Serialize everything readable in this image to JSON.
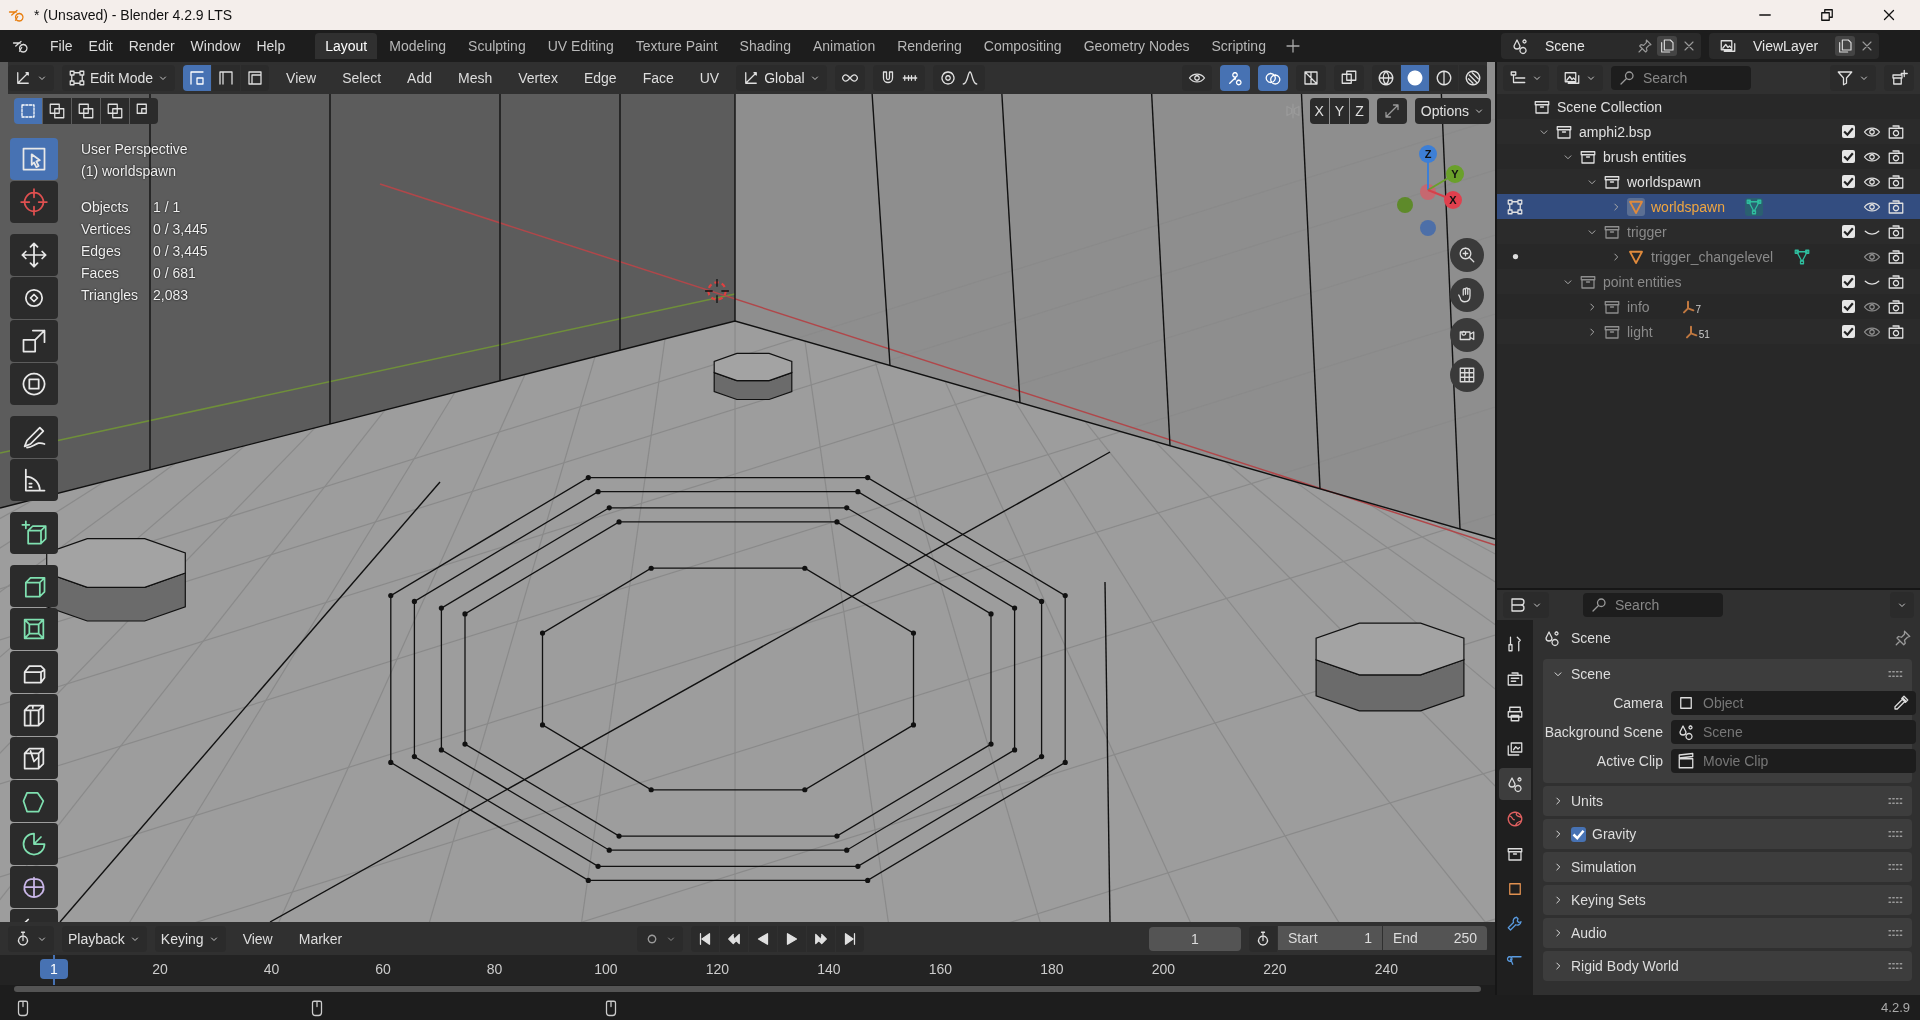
{
  "window": {
    "title": "* (Unsaved) - Blender 4.2.9 LTS"
  },
  "menu": [
    "File",
    "Edit",
    "Render",
    "Window",
    "Help"
  ],
  "workspaces": [
    {
      "label": "Layout",
      "selected": true
    },
    {
      "label": "Modeling",
      "selected": false
    },
    {
      "label": "Sculpting",
      "selected": false
    },
    {
      "label": "UV Editing",
      "selected": false
    },
    {
      "label": "Texture Paint",
      "selected": false
    },
    {
      "label": "Shading",
      "selected": false
    },
    {
      "label": "Animation",
      "selected": false
    },
    {
      "label": "Rendering",
      "selected": false
    },
    {
      "label": "Compositing",
      "selected": false
    },
    {
      "label": "Geometry Nodes",
      "selected": false
    },
    {
      "label": "Scripting",
      "selected": false
    }
  ],
  "scene": {
    "name": "Scene"
  },
  "view_layer": {
    "name": "ViewLayer"
  },
  "viewport": {
    "mode": "Edit Mode",
    "select_modes": [
      {
        "kind": "vertex",
        "selected": true
      },
      {
        "kind": "edge",
        "selected": false
      },
      {
        "kind": "face",
        "selected": false
      }
    ],
    "menus": [
      "View",
      "Select",
      "Add",
      "Mesh",
      "Vertex",
      "Edge",
      "Face",
      "UV"
    ],
    "orientation": "Global",
    "gizmos_on": true,
    "overlays_on": true,
    "shading": [
      {
        "kind": "wireframe",
        "selected": false
      },
      {
        "kind": "solid",
        "selected": true
      },
      {
        "kind": "material",
        "selected": false
      },
      {
        "kind": "rendered",
        "selected": false
      }
    ],
    "box_modes": [
      {
        "kind": "new",
        "selected": true
      },
      {
        "kind": "extend",
        "selected": false
      },
      {
        "kind": "subtract",
        "selected": false
      },
      {
        "kind": "invert",
        "selected": false
      },
      {
        "kind": "intersect",
        "selected": false
      }
    ],
    "mirror_axes": [
      {
        "label": "X",
        "selected": false
      },
      {
        "label": "Y",
        "selected": false
      },
      {
        "label": "Z",
        "selected": false
      }
    ],
    "options": "Options",
    "view_name": "User Perspective",
    "object_name": "(1) worldspawn",
    "stats": [
      {
        "label": "Objects",
        "value": "1 / 1"
      },
      {
        "label": "Vertices",
        "value": "0 / 3,445"
      },
      {
        "label": "Edges",
        "value": "0 / 3,445"
      },
      {
        "label": "Faces",
        "value": "0 / 681"
      },
      {
        "label": "Triangles",
        "value": "2,083"
      }
    ],
    "axis_labels": [
      "Z",
      "Y",
      "X"
    ],
    "tools": [
      {
        "kind": "select-box",
        "selected": true
      },
      {
        "kind": "cursor",
        "selected": false
      },
      {
        "kind": "move",
        "selected": false
      },
      {
        "kind": "rotate",
        "selected": false
      },
      {
        "kind": "scale",
        "selected": false
      },
      {
        "kind": "transform",
        "selected": false
      },
      {
        "kind": "annotate",
        "selected": false
      },
      {
        "kind": "measure",
        "selected": false
      },
      {
        "kind": "add-cube",
        "selected": false
      },
      {
        "kind": "extrude",
        "selected": false
      },
      {
        "kind": "inset",
        "selected": false
      },
      {
        "kind": "bevel",
        "selected": false
      },
      {
        "kind": "loop-cut",
        "selected": false
      },
      {
        "kind": "knife",
        "selected": false
      },
      {
        "kind": "poly-build",
        "selected": false
      },
      {
        "kind": "spin",
        "selected": false
      },
      {
        "kind": "smooth",
        "selected": false
      },
      {
        "kind": "shear",
        "selected": false
      }
    ]
  },
  "outliner": {
    "search": {
      "placeholder": "Search"
    },
    "root": "Scene Collection",
    "tree": [
      {
        "name": "amphi2.bsp",
        "kind": "collection",
        "expanded": true,
        "selected": false,
        "dimmed": false,
        "visible": true,
        "checked": true,
        "children": [
          {
            "name": "brush entities",
            "kind": "collection",
            "expanded": true,
            "selected": false,
            "dimmed": false,
            "visible": true,
            "checked": true,
            "children": [
              {
                "name": "worldspawn",
                "kind": "collection",
                "expanded": true,
                "selected": false,
                "dimmed": false,
                "visible": true,
                "checked": true,
                "children": [
                  {
                    "name": "worldspawn",
                    "kind": "mesh",
                    "expanded": false,
                    "selected": true,
                    "dimmed": false,
                    "visible": true,
                    "editing": true
                  }
                ]
              },
              {
                "name": "trigger",
                "kind": "collection",
                "expanded": true,
                "selected": false,
                "dimmed": true,
                "visible": false,
                "checked": true,
                "children": [
                  {
                    "name": "trigger_changelevel",
                    "kind": "mesh",
                    "expanded": false,
                    "selected": false,
                    "dimmed": true,
                    "visible": true,
                    "editing": false
                  }
                ]
              }
            ]
          },
          {
            "name": "point entities",
            "kind": "collection",
            "expanded": true,
            "selected": false,
            "dimmed": true,
            "visible": false,
            "checked": true,
            "children": [
              {
                "name": "info",
                "kind": "collection",
                "expanded": false,
                "selected": false,
                "dimmed": true,
                "visible": true,
                "checked": true,
                "count": "7"
              },
              {
                "name": "light",
                "kind": "collection",
                "expanded": false,
                "selected": false,
                "dimmed": true,
                "visible": true,
                "checked": true,
                "count": "51"
              }
            ]
          }
        ]
      }
    ]
  },
  "properties": {
    "search": {
      "placeholder": "Search"
    },
    "tabs": [
      {
        "kind": "tool",
        "selected": false
      },
      {
        "kind": "render",
        "selected": false
      },
      {
        "kind": "output",
        "selected": false
      },
      {
        "kind": "view-layer",
        "selected": false
      },
      {
        "kind": "scene",
        "selected": true
      },
      {
        "kind": "world",
        "selected": false
      },
      {
        "kind": "collection",
        "selected": false
      },
      {
        "kind": "object",
        "selected": false
      },
      {
        "kind": "modifiers",
        "selected": false
      },
      {
        "kind": "particles",
        "selected": false
      }
    ],
    "context": "Scene",
    "panels": [
      {
        "title": "Scene",
        "expanded": true,
        "fields": [
          {
            "label": "Camera",
            "kind": "object",
            "placeholder": "Object"
          },
          {
            "label": "Background Scene",
            "kind": "scene",
            "placeholder": "Scene"
          },
          {
            "label": "Active Clip",
            "kind": "clip",
            "placeholder": "Movie Clip"
          }
        ]
      },
      {
        "title": "Units",
        "expanded": false
      },
      {
        "title": "Gravity",
        "expanded": false,
        "checked": true
      },
      {
        "title": "Simulation",
        "expanded": false
      },
      {
        "title": "Keying Sets",
        "expanded": false
      },
      {
        "title": "Audio",
        "expanded": false
      },
      {
        "title": "Rigid Body World",
        "expanded": false
      }
    ]
  },
  "timeline": {
    "menus": [
      {
        "label": "Playback",
        "kind": "dropdown"
      },
      {
        "label": "Keying",
        "kind": "dropdown"
      },
      {
        "label": "View",
        "kind": "menu"
      },
      {
        "label": "Marker",
        "kind": "menu"
      }
    ],
    "current_frame": "1",
    "start": {
      "label": "Start",
      "value": "1"
    },
    "end": {
      "label": "End",
      "value": "250"
    },
    "ruler": {
      "current": "1",
      "labels": [
        "20",
        "40",
        "60",
        "80",
        "100",
        "120",
        "140",
        "160",
        "180",
        "200",
        "220",
        "240"
      ]
    }
  },
  "status_bar": {
    "version": "4.2.9"
  }
}
